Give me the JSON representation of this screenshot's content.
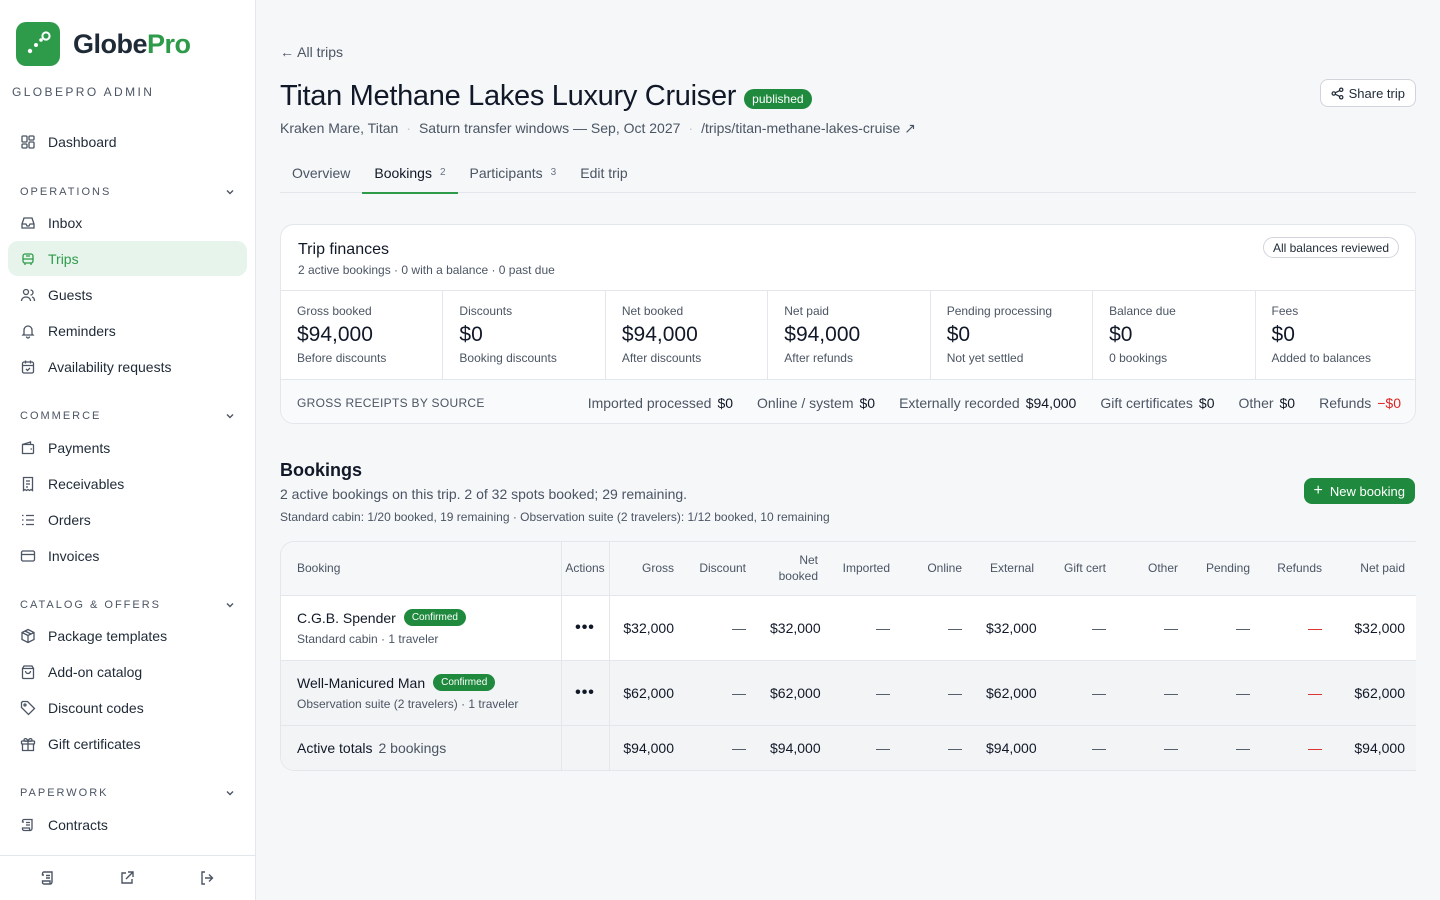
{
  "app": {
    "brand_main": "Globe",
    "brand_accent": "Pro",
    "admin_label": "GLOBEPRO ADMIN",
    "accent_color": "#2e9b4a"
  },
  "sidebar": {
    "top": [
      {
        "label": "Dashboard",
        "icon": "dashboard-icon"
      }
    ],
    "sections": [
      {
        "title": "OPERATIONS",
        "items": [
          {
            "label": "Inbox",
            "icon": "inbox-icon"
          },
          {
            "label": "Trips",
            "icon": "trips-icon",
            "active": true
          },
          {
            "label": "Guests",
            "icon": "guests-icon"
          },
          {
            "label": "Reminders",
            "icon": "bell-icon"
          },
          {
            "label": "Availability requests",
            "icon": "calendar-icon"
          }
        ]
      },
      {
        "title": "COMMERCE",
        "items": [
          {
            "label": "Payments",
            "icon": "wallet-icon"
          },
          {
            "label": "Receivables",
            "icon": "receipt-icon"
          },
          {
            "label": "Orders",
            "icon": "list-icon"
          },
          {
            "label": "Invoices",
            "icon": "card-icon"
          }
        ]
      },
      {
        "title": "CATALOG & OFFERS",
        "items": [
          {
            "label": "Package templates",
            "icon": "package-icon"
          },
          {
            "label": "Add-on catalog",
            "icon": "bag-icon"
          },
          {
            "label": "Discount codes",
            "icon": "tag-icon"
          },
          {
            "label": "Gift certificates",
            "icon": "gift-icon"
          }
        ]
      },
      {
        "title": "PAPERWORK",
        "items": [
          {
            "label": "Contracts",
            "icon": "scroll-icon"
          }
        ]
      }
    ]
  },
  "header": {
    "back": "← All trips",
    "title": "Titan Methane Lakes Luxury Cruiser",
    "status": "published",
    "share": "Share trip",
    "location": "Kraken Mare, Titan",
    "schedule": "Saturn transfer windows — Sep, Oct 2027",
    "path": "/trips/titan-methane-lakes-cruise ↗"
  },
  "tabs": [
    {
      "label": "Overview",
      "count": ""
    },
    {
      "label": "Bookings",
      "count": "2",
      "active": true
    },
    {
      "label": "Participants",
      "count": "3"
    },
    {
      "label": "Edit trip",
      "count": ""
    }
  ],
  "finances": {
    "title": "Trip finances",
    "subtitle": "2 active bookings · 0 with a balance · 0 past due",
    "reviewed": "All balances reviewed",
    "stats": [
      {
        "label": "Gross booked",
        "value": "$94,000",
        "note": "Before discounts"
      },
      {
        "label": "Discounts",
        "value": "$0",
        "note": "Booking discounts"
      },
      {
        "label": "Net booked",
        "value": "$94,000",
        "note": "After discounts"
      },
      {
        "label": "Net paid",
        "value": "$94,000",
        "note": "After refunds"
      },
      {
        "label": "Pending processing",
        "value": "$0",
        "note": "Not yet settled"
      },
      {
        "label": "Balance due",
        "value": "$0",
        "note": "0 bookings"
      },
      {
        "label": "Fees",
        "value": "$0",
        "note": "Added to balances"
      }
    ],
    "receipts_title": "GROSS RECEIPTS BY SOURCE",
    "receipts": [
      {
        "label": "Imported processed",
        "value": "$0"
      },
      {
        "label": "Online / system",
        "value": "$0"
      },
      {
        "label": "Externally recorded",
        "value": "$94,000"
      },
      {
        "label": "Gift certificates",
        "value": "$0"
      },
      {
        "label": "Other",
        "value": "$0"
      },
      {
        "label": "Refunds",
        "value": "−$0",
        "negative": true
      }
    ]
  },
  "bookings": {
    "title": "Bookings",
    "subtitle": "2 active bookings on this trip. 2 of 32 spots booked; 29 remaining.",
    "detail": "Standard cabin: 1/20 booked, 19 remaining · Observation suite (2 travelers): 1/12 booked, 10 remaining",
    "new_button": "New booking",
    "columns": [
      "Booking",
      "Actions",
      "Gross",
      "Discount",
      "Net booked",
      "Imported",
      "Online",
      "External",
      "Gift cert",
      "Other",
      "Pending",
      "Refunds",
      "Net paid"
    ],
    "rows": [
      {
        "name": "C.G.B. Spender",
        "status": "Confirmed",
        "sub": "Standard cabin · 1 traveler",
        "cells": [
          "$32,000",
          "—",
          "$32,000",
          "—",
          "—",
          "$32,000",
          "—",
          "—",
          "—",
          "—",
          "$32,000"
        ]
      },
      {
        "name": "Well-Manicured Man",
        "status": "Confirmed",
        "sub": "Observation suite (2 travelers) · 1 traveler",
        "cells": [
          "$62,000",
          "—",
          "$62,000",
          "—",
          "—",
          "$62,000",
          "—",
          "—",
          "—",
          "—",
          "$62,000"
        ]
      }
    ],
    "totals": {
      "label": "Active totals",
      "count": "2 bookings",
      "cells": [
        "$94,000",
        "—",
        "$94,000",
        "—",
        "—",
        "$94,000",
        "—",
        "—",
        "—",
        "—",
        "$94,000"
      ]
    },
    "actions_glyph": "•••"
  }
}
